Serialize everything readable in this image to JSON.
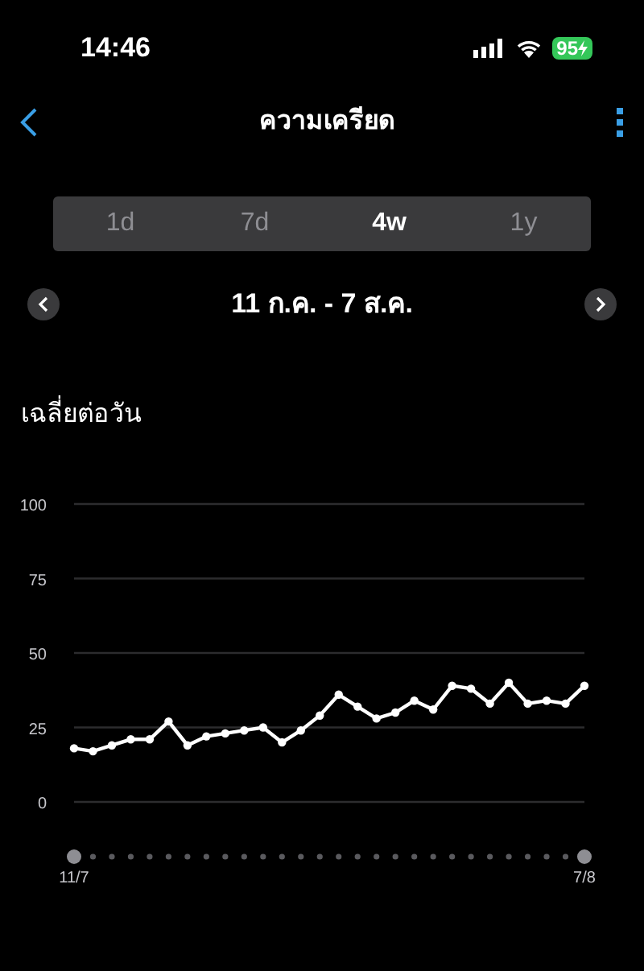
{
  "status_bar": {
    "time": "14:46",
    "battery": "95"
  },
  "nav": {
    "title": "ความเครียด"
  },
  "tabs": [
    {
      "label": "1d",
      "selected": false
    },
    {
      "label": "7d",
      "selected": false
    },
    {
      "label": "4w",
      "selected": true
    },
    {
      "label": "1y",
      "selected": false
    }
  ],
  "date_range": "11 ก.ค. - 7 ส.ค.",
  "section_title": "เฉลี่ยต่อวัน",
  "chart": {
    "chart_data": {
      "type": "line",
      "categories": [
        "11/7",
        null,
        null,
        null,
        null,
        null,
        null,
        null,
        null,
        null,
        null,
        null,
        null,
        null,
        null,
        null,
        null,
        null,
        null,
        null,
        null,
        null,
        null,
        null,
        null,
        null,
        null,
        "7/8"
      ],
      "grid": true,
      "series": [
        {
          "color": "#ffffff",
          "marker": true,
          "values": [
            18,
            17,
            19,
            21,
            21,
            27,
            19,
            22,
            23,
            24,
            25,
            20,
            24,
            29,
            36,
            32,
            28,
            30,
            34,
            31,
            39,
            38,
            33,
            40,
            33,
            34,
            33,
            39
          ]
        }
      ],
      "ylim": [
        0,
        100
      ],
      "yticks": [
        0,
        25,
        50,
        75,
        100
      ]
    }
  }
}
